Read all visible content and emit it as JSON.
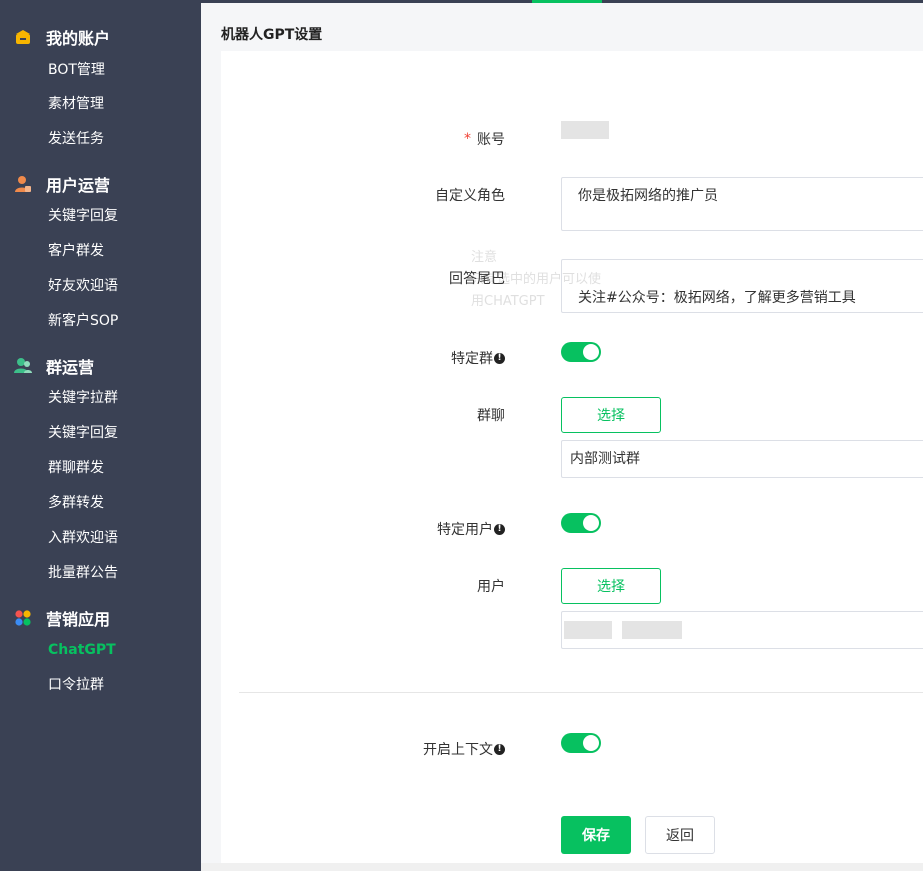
{
  "sidebar": {
    "sections": [
      {
        "title": "我的账户",
        "icon": "wallet-icon",
        "items": [
          "BOT管理",
          "素材管理",
          "发送任务"
        ]
      },
      {
        "title": "用户运营",
        "icon": "user-icon",
        "items": [
          "关键字回复",
          "客户群发",
          "好友欢迎语",
          "新客户SOP"
        ]
      },
      {
        "title": "群运营",
        "icon": "group-icon",
        "items": [
          "关键字拉群",
          "关键字回复",
          "群聊群发",
          "多群转发",
          "入群欢迎语",
          "批量群公告"
        ]
      },
      {
        "title": "营销应用",
        "icon": "apps-icon",
        "items": [
          "ChatGPT",
          "口令拉群"
        ]
      }
    ],
    "active_item": "ChatGPT"
  },
  "page": {
    "title": "机器人GPT设置"
  },
  "form": {
    "account_label": "账号",
    "role_label": "自定义角色",
    "role_value": "你是极拓网络的推广员",
    "tail_label": "回答尾巴",
    "tail_value": "关注#公众号：极拓网络，了解更多营销工具",
    "specific_group_label": "特定群",
    "group_chat_label": "群聊",
    "group_select_label": "选择",
    "group_selected": "内部测试群",
    "specific_user_label": "特定用户",
    "user_label": "用户",
    "user_select_label": "选择",
    "context_label": "开启上下文",
    "save_label": "保存",
    "back_label": "返回",
    "info_glyph": "!"
  },
  "tooltip": {
    "title": "注意",
    "body": "只有选中的用户可以使用CHATGPT"
  },
  "colors": {
    "accent": "#07c160",
    "sidebar_bg": "#3a4154",
    "required": "#f04134"
  }
}
